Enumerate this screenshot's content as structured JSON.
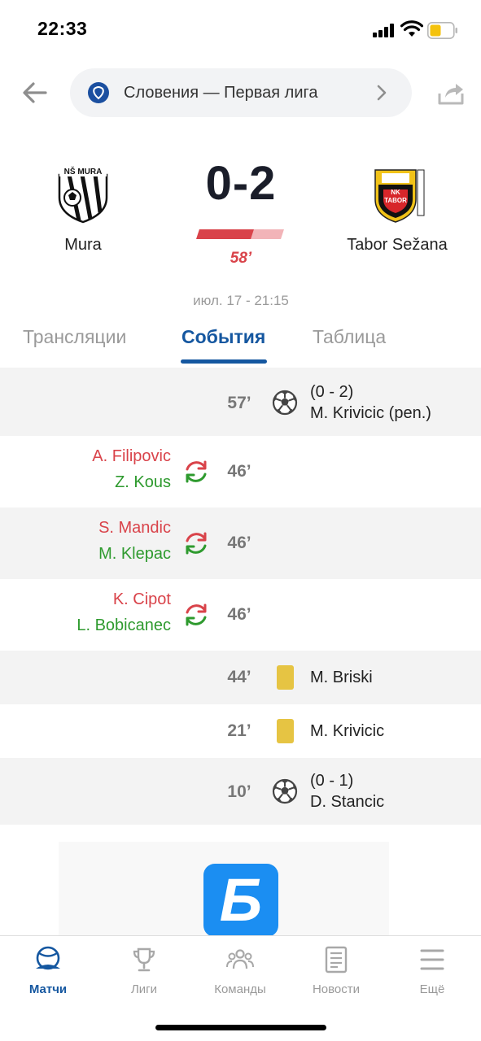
{
  "status_bar": {
    "time": "22:33"
  },
  "header": {
    "league_name": "Словения — Первая лига",
    "back_icon": "arrow-left-icon",
    "share_icon": "share-icon"
  },
  "match": {
    "home_team": "Mura",
    "home_logo_text": "NŠ MURA",
    "away_team": "Tabor Sežana",
    "away_logo_text": "NK TABOR",
    "score": "0-2",
    "minute": "58’",
    "progress_fraction": 0.64,
    "date": "июл. 17 - 21:15"
  },
  "tabs": [
    {
      "label": "Трансляции",
      "active": false
    },
    {
      "label": "События",
      "active": true
    },
    {
      "label": "Таблица",
      "active": false
    }
  ],
  "events": [
    {
      "type": "goal",
      "minute": "57’",
      "side": "away",
      "line1": "(0 - 2)",
      "line2": "M. Krivicic (pen.)"
    },
    {
      "type": "substitution",
      "minute": "46’",
      "side": "home",
      "player_out": "A. Filipovic",
      "player_in": "Z. Kous"
    },
    {
      "type": "substitution",
      "minute": "46’",
      "side": "home",
      "player_out": "S. Mandic",
      "player_in": "M. Klepac"
    },
    {
      "type": "substitution",
      "minute": "46’",
      "side": "home",
      "player_out": "K. Cipot",
      "player_in": "L. Bobicanec"
    },
    {
      "type": "yellow-card",
      "minute": "44’",
      "side": "away",
      "player": "M. Briski"
    },
    {
      "type": "yellow-card",
      "minute": "21’",
      "side": "away",
      "player": "M. Krivicic"
    },
    {
      "type": "goal",
      "minute": "10’",
      "side": "away",
      "line1": "(0 - 1)",
      "line2": "D. Stancic"
    }
  ],
  "ad": {
    "logo_letter": "Б"
  },
  "bottom_nav": [
    {
      "label": "Матчи",
      "icon": "stadium-icon",
      "active": true
    },
    {
      "label": "Лиги",
      "icon": "trophy-icon",
      "active": false
    },
    {
      "label": "Команды",
      "icon": "team-icon",
      "active": false
    },
    {
      "label": "Новости",
      "icon": "news-icon",
      "active": false
    },
    {
      "label": "Ещё",
      "icon": "menu-icon",
      "active": false
    }
  ],
  "colors": {
    "accent": "#1557a0",
    "live_red": "#d9434a",
    "sub_in_green": "#2e9a2e",
    "yellow_card": "#e6c443",
    "row_shade": "#f3f3f3"
  }
}
